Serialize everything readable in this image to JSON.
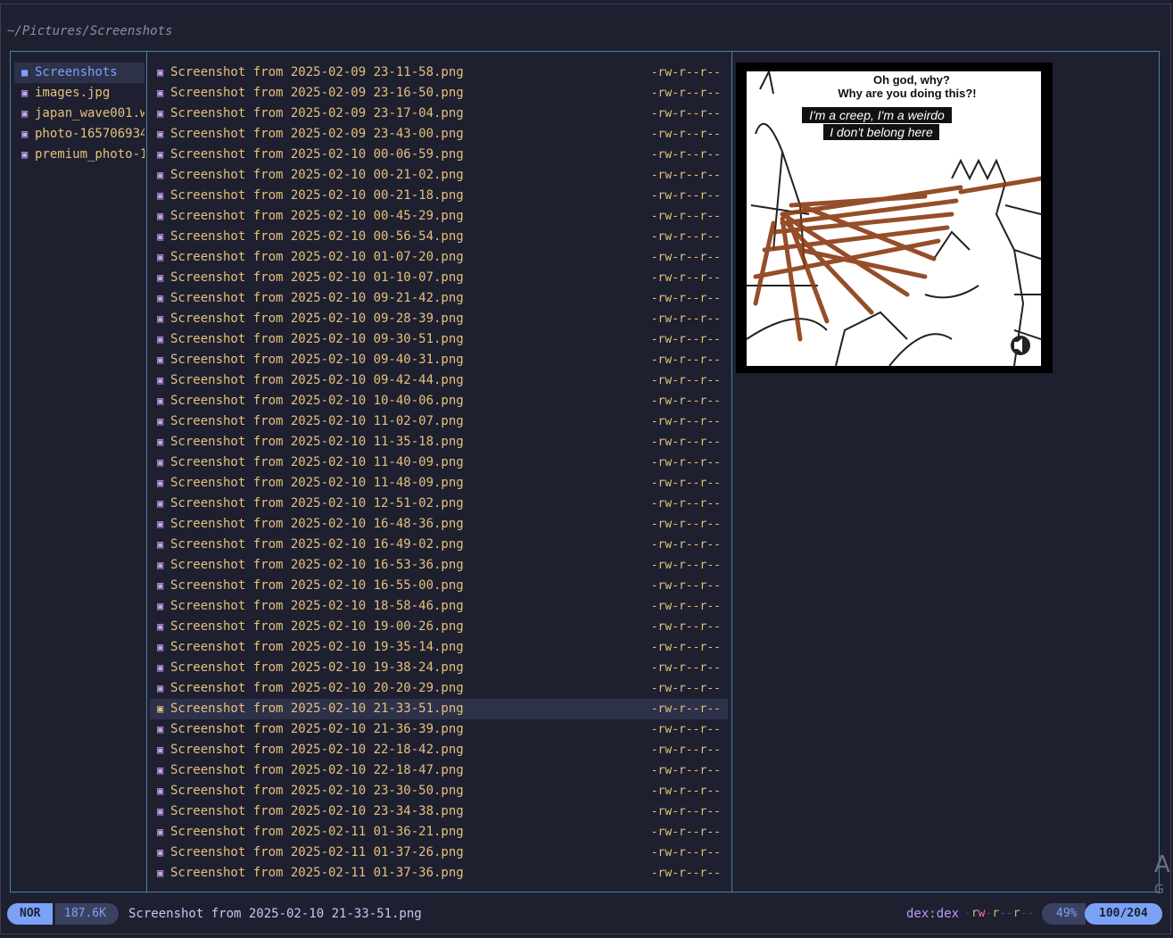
{
  "path": "~/Pictures/Screenshots",
  "icons": {
    "folder": "folder-icon",
    "image": "image-file-icon"
  },
  "parent_items": [
    {
      "name": "Screenshots",
      "type": "dir"
    },
    {
      "name": "images.jpg",
      "type": "image"
    },
    {
      "name": "japan_wave001.w",
      "type": "image"
    },
    {
      "name": "photo-165706934",
      "type": "image"
    },
    {
      "name": "premium_photo-1",
      "type": "image"
    }
  ],
  "files": [
    {
      "name": "Screenshot from 2025-02-09 23-11-58.png",
      "perm": "-rw-r--r--"
    },
    {
      "name": "Screenshot from 2025-02-09 23-16-50.png",
      "perm": "-rw-r--r--"
    },
    {
      "name": "Screenshot from 2025-02-09 23-17-04.png",
      "perm": "-rw-r--r--"
    },
    {
      "name": "Screenshot from 2025-02-09 23-43-00.png",
      "perm": "-rw-r--r--"
    },
    {
      "name": "Screenshot from 2025-02-10 00-06-59.png",
      "perm": "-rw-r--r--"
    },
    {
      "name": "Screenshot from 2025-02-10 00-21-02.png",
      "perm": "-rw-r--r--"
    },
    {
      "name": "Screenshot from 2025-02-10 00-21-18.png",
      "perm": "-rw-r--r--"
    },
    {
      "name": "Screenshot from 2025-02-10 00-45-29.png",
      "perm": "-rw-r--r--"
    },
    {
      "name": "Screenshot from 2025-02-10 00-56-54.png",
      "perm": "-rw-r--r--"
    },
    {
      "name": "Screenshot from 2025-02-10 01-07-20.png",
      "perm": "-rw-r--r--"
    },
    {
      "name": "Screenshot from 2025-02-10 01-10-07.png",
      "perm": "-rw-r--r--"
    },
    {
      "name": "Screenshot from 2025-02-10 09-21-42.png",
      "perm": "-rw-r--r--"
    },
    {
      "name": "Screenshot from 2025-02-10 09-28-39.png",
      "perm": "-rw-r--r--"
    },
    {
      "name": "Screenshot from 2025-02-10 09-30-51.png",
      "perm": "-rw-r--r--"
    },
    {
      "name": "Screenshot from 2025-02-10 09-40-31.png",
      "perm": "-rw-r--r--"
    },
    {
      "name": "Screenshot from 2025-02-10 09-42-44.png",
      "perm": "-rw-r--r--"
    },
    {
      "name": "Screenshot from 2025-02-10 10-40-06.png",
      "perm": "-rw-r--r--"
    },
    {
      "name": "Screenshot from 2025-02-10 11-02-07.png",
      "perm": "-rw-r--r--"
    },
    {
      "name": "Screenshot from 2025-02-10 11-35-18.png",
      "perm": "-rw-r--r--"
    },
    {
      "name": "Screenshot from 2025-02-10 11-40-09.png",
      "perm": "-rw-r--r--"
    },
    {
      "name": "Screenshot from 2025-02-10 11-48-09.png",
      "perm": "-rw-r--r--"
    },
    {
      "name": "Screenshot from 2025-02-10 12-51-02.png",
      "perm": "-rw-r--r--"
    },
    {
      "name": "Screenshot from 2025-02-10 16-48-36.png",
      "perm": "-rw-r--r--"
    },
    {
      "name": "Screenshot from 2025-02-10 16-49-02.png",
      "perm": "-rw-r--r--"
    },
    {
      "name": "Screenshot from 2025-02-10 16-53-36.png",
      "perm": "-rw-r--r--"
    },
    {
      "name": "Screenshot from 2025-02-10 16-55-00.png",
      "perm": "-rw-r--r--"
    },
    {
      "name": "Screenshot from 2025-02-10 18-58-46.png",
      "perm": "-rw-r--r--"
    },
    {
      "name": "Screenshot from 2025-02-10 19-00-26.png",
      "perm": "-rw-r--r--"
    },
    {
      "name": "Screenshot from 2025-02-10 19-35-14.png",
      "perm": "-rw-r--r--"
    },
    {
      "name": "Screenshot from 2025-02-10 19-38-24.png",
      "perm": "-rw-r--r--"
    },
    {
      "name": "Screenshot from 2025-02-10 20-20-29.png",
      "perm": "-rw-r--r--"
    },
    {
      "name": "Screenshot from 2025-02-10 21-33-51.png",
      "perm": "-rw-r--r--",
      "selected": true
    },
    {
      "name": "Screenshot from 2025-02-10 21-36-39.png",
      "perm": "-rw-r--r--"
    },
    {
      "name": "Screenshot from 2025-02-10 22-18-42.png",
      "perm": "-rw-r--r--"
    },
    {
      "name": "Screenshot from 2025-02-10 22-18-47.png",
      "perm": "-rw-r--r--"
    },
    {
      "name": "Screenshot from 2025-02-10 23-30-50.png",
      "perm": "-rw-r--r--"
    },
    {
      "name": "Screenshot from 2025-02-10 23-34-38.png",
      "perm": "-rw-r--r--"
    },
    {
      "name": "Screenshot from 2025-02-11 01-36-21.png",
      "perm": "-rw-r--r--"
    },
    {
      "name": "Screenshot from 2025-02-11 01-37-26.png",
      "perm": "-rw-r--r--"
    },
    {
      "name": "Screenshot from 2025-02-11 01-37-36.png",
      "perm": "-rw-r--r--"
    }
  ],
  "preview": {
    "caption_top_1": "Oh god, why?",
    "caption_top_2": "Why are you doing this?!",
    "subtitle_1": "I'm a creep, I'm a weirdo",
    "subtitle_2": "I don't belong here",
    "icon": "speaker-icon"
  },
  "status": {
    "mode": "NOR",
    "size": "187.6K",
    "filename": "Screenshot from 2025-02-10 21-33-51.png",
    "owner": "dex:dex",
    "perms": [
      "-",
      "r",
      "w",
      "-",
      "r",
      "-",
      "-",
      "r",
      "-",
      "-"
    ],
    "percent": "49%",
    "position": "100/204"
  },
  "watermark": {
    "line1": "A",
    "line2": "G"
  },
  "colors": {
    "background": "#1e2030",
    "border": "#4a7fa8",
    "file_text": "#e6c07b",
    "accent": "#7aa2f7",
    "selection": "#2d3149"
  }
}
